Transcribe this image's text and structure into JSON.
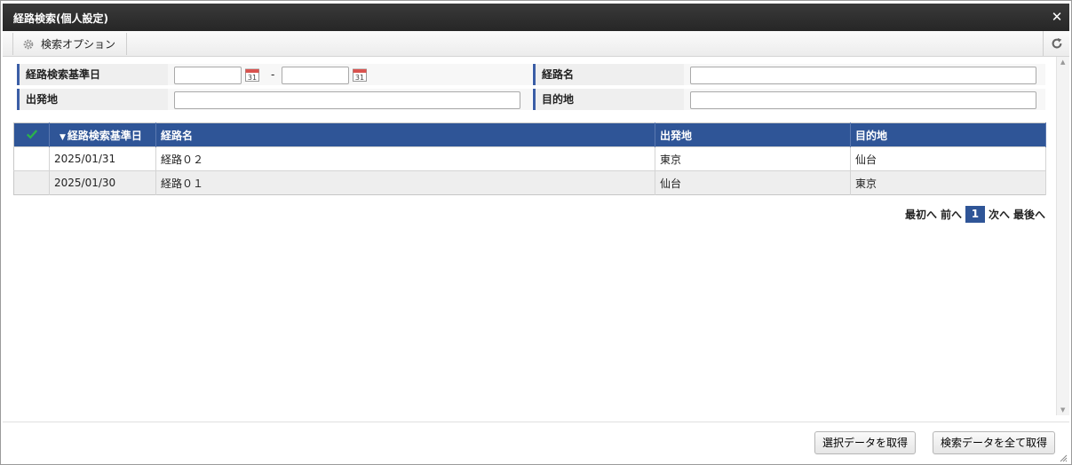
{
  "dialog": {
    "title": "経路検索(個人設定)"
  },
  "toolbar": {
    "search_option_label": "検索オプション"
  },
  "form": {
    "base_date_label": "経路検索基準日",
    "date_separator": "-",
    "from_date": "",
    "to_date": "",
    "route_name_label": "経路名",
    "route_name_value": "",
    "departure_label": "出発地",
    "departure_value": "",
    "destination_label": "目的地",
    "destination_value": "",
    "calendar_day": "31"
  },
  "grid": {
    "columns": [
      "経路検索基準日",
      "経路名",
      "出発地",
      "目的地"
    ],
    "sort_indicator": "▼",
    "rows": [
      {
        "date": "2025/01/31",
        "name": "経路０２",
        "from": "東京",
        "to": "仙台"
      },
      {
        "date": "2025/01/30",
        "name": "経路０１",
        "from": "仙台",
        "to": "東京"
      }
    ]
  },
  "pager": {
    "first": "最初へ",
    "prev": "前へ",
    "current": "1",
    "next": "次へ",
    "last": "最後へ"
  },
  "footer": {
    "get_selected": "選択データを取得",
    "get_all": "検索データを全て取得"
  },
  "colors": {
    "header": "#2f5597",
    "accent_bar": "#3b5ea6",
    "check": "#2bb24c"
  }
}
